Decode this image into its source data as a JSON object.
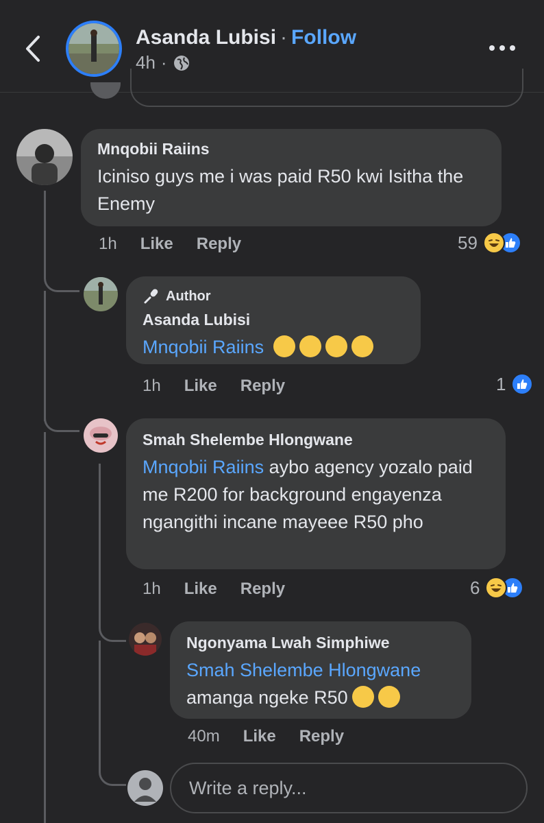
{
  "header": {
    "name": "Asanda Lubisi",
    "separator": "·",
    "follow": "Follow",
    "time": "4h",
    "time_sep": "·",
    "audience_icon": "globe-icon",
    "more_icon": "more-options-icon",
    "back_icon": "chevron-left-icon"
  },
  "comments": [
    {
      "name": "Mnqobii Raiins",
      "text": "Iciniso guys me i was paid R50 kwi Isitha the Enemy",
      "time": "1h",
      "like": "Like",
      "reply": "Reply",
      "reaction_count": "59",
      "reactions": [
        "haha",
        "like"
      ]
    },
    {
      "badge": "Author",
      "name": "Asanda Lubisi",
      "mention": "Mnqobii Raiins",
      "emojis": [
        "joy",
        "sob",
        "sob",
        "sob"
      ],
      "time": "1h",
      "like": "Like",
      "reply": "Reply",
      "reaction_count": "1",
      "reactions": [
        "like"
      ]
    },
    {
      "name": "Smah Shelembe Hlongwane",
      "mention": "Mnqobii Raiins",
      "text_line1": " aybo agency yozalo",
      "text_rest": "paid me R200 for background engayenza ngangithi incane mayeee R50 pho",
      "time": "1h",
      "like": "Like",
      "reply": "Reply",
      "reaction_count": "6",
      "reactions": [
        "haha",
        "like"
      ]
    },
    {
      "name": "Ngonyama Lwah Simphiwe",
      "mention": "Smah Shelembe Hlongwane",
      "text": "amanga ngeke R50",
      "emojis": [
        "rofl",
        "rofl"
      ],
      "time": "40m",
      "like": "Like",
      "reply": "Reply"
    }
  ],
  "composer": {
    "placeholder": "Write a reply..."
  },
  "colors": {
    "background": "#252527",
    "bubble": "#3a3b3c",
    "accent": "#5aa7ff",
    "like_blue": "#2d7ff9",
    "emoji_yellow": "#f7c948"
  }
}
